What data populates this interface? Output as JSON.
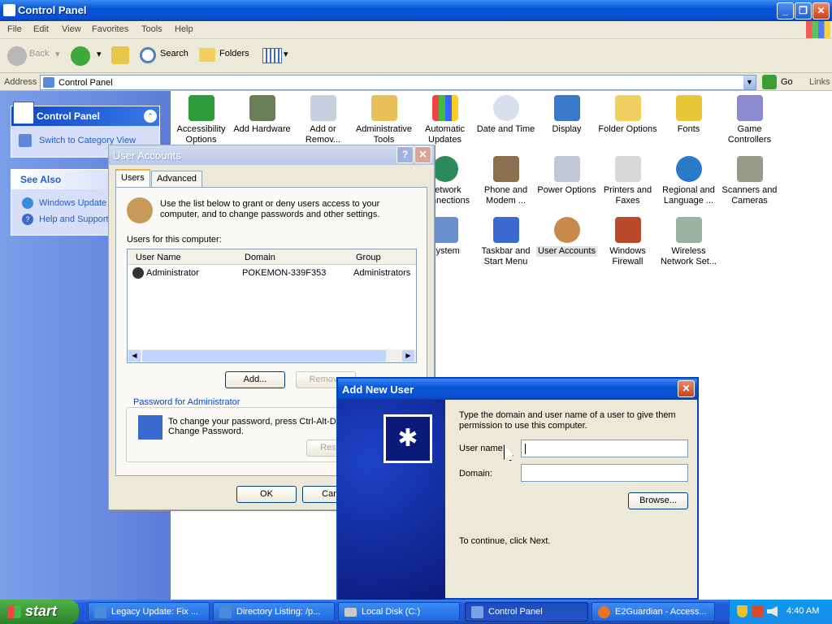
{
  "window": {
    "title": "Control Panel"
  },
  "menu": [
    "File",
    "Edit",
    "View",
    "Favorites",
    "Tools",
    "Help"
  ],
  "toolbar": {
    "back": "Back",
    "search": "Search",
    "folders": "Folders"
  },
  "address": {
    "label": "Address",
    "value": "Control Panel",
    "go": "Go",
    "links": "Links"
  },
  "sidebar": {
    "panel_title": "Control Panel",
    "switch_link": "Switch to Category View",
    "see_also": "See Also",
    "links": [
      "Windows Update",
      "Help and Support"
    ]
  },
  "icons": [
    [
      "Accessibility",
      "Options"
    ],
    [
      "Add Hardware",
      ""
    ],
    [
      "Add or",
      "Remov..."
    ],
    [
      "Administrative",
      "Tools"
    ],
    [
      "Automatic",
      "Updates"
    ],
    [
      "Date and Time",
      ""
    ],
    [
      "Display",
      ""
    ],
    [
      "Folder Options",
      ""
    ],
    [
      "Fonts",
      ""
    ],
    [
      "Game",
      "Controllers"
    ],
    [
      "Network",
      "Connections"
    ],
    [
      "Phone and",
      "Modem ..."
    ],
    [
      "Power Options",
      ""
    ],
    [
      "Printers and",
      "Faxes"
    ],
    [
      "Regional and",
      "Language ..."
    ],
    [
      "Scanners and",
      "Cameras"
    ],
    [
      "System",
      ""
    ],
    [
      "Taskbar and",
      "Start Menu"
    ],
    [
      "User Accounts",
      ""
    ],
    [
      "Windows",
      "Firewall"
    ],
    [
      "Wireless",
      "Network Set..."
    ]
  ],
  "user_accounts": {
    "title": "User Accounts",
    "tabs": [
      "Users",
      "Advanced"
    ],
    "intro_line1": "Use the list below to grant or deny users access to your",
    "intro_line2": "computer, and to change passwords and other settings.",
    "users_label": "Users for this computer:",
    "columns": [
      "User Name",
      "Domain",
      "Group"
    ],
    "rows": [
      [
        "Administrator",
        "POKEMON-339F353",
        "Administrators"
      ]
    ],
    "add": "Add...",
    "remove": "Remove",
    "password_group": "Password for Administrator",
    "pw_line1": "To change your password, press Ctrl-Alt-D",
    "pw_line2": "Change Password.",
    "reset": "Rese",
    "ok": "OK",
    "cancel": "Canc"
  },
  "add_new_user": {
    "title": "Add New User",
    "desc_line1": "Type the domain and user name of a user to give them",
    "desc_line2": "permission to use this computer.",
    "username_label": "User name:",
    "domain_label": "Domain:",
    "browse": "Browse...",
    "continue": "To continue, click Next."
  },
  "taskbar": {
    "start": "start",
    "tasks": [
      "Legacy Update: Fix ...",
      "Directory Listing: /p...",
      "Local Disk (C:)",
      "Control Panel",
      "E2Guardian - Access..."
    ],
    "clock": "4:40 AM"
  }
}
